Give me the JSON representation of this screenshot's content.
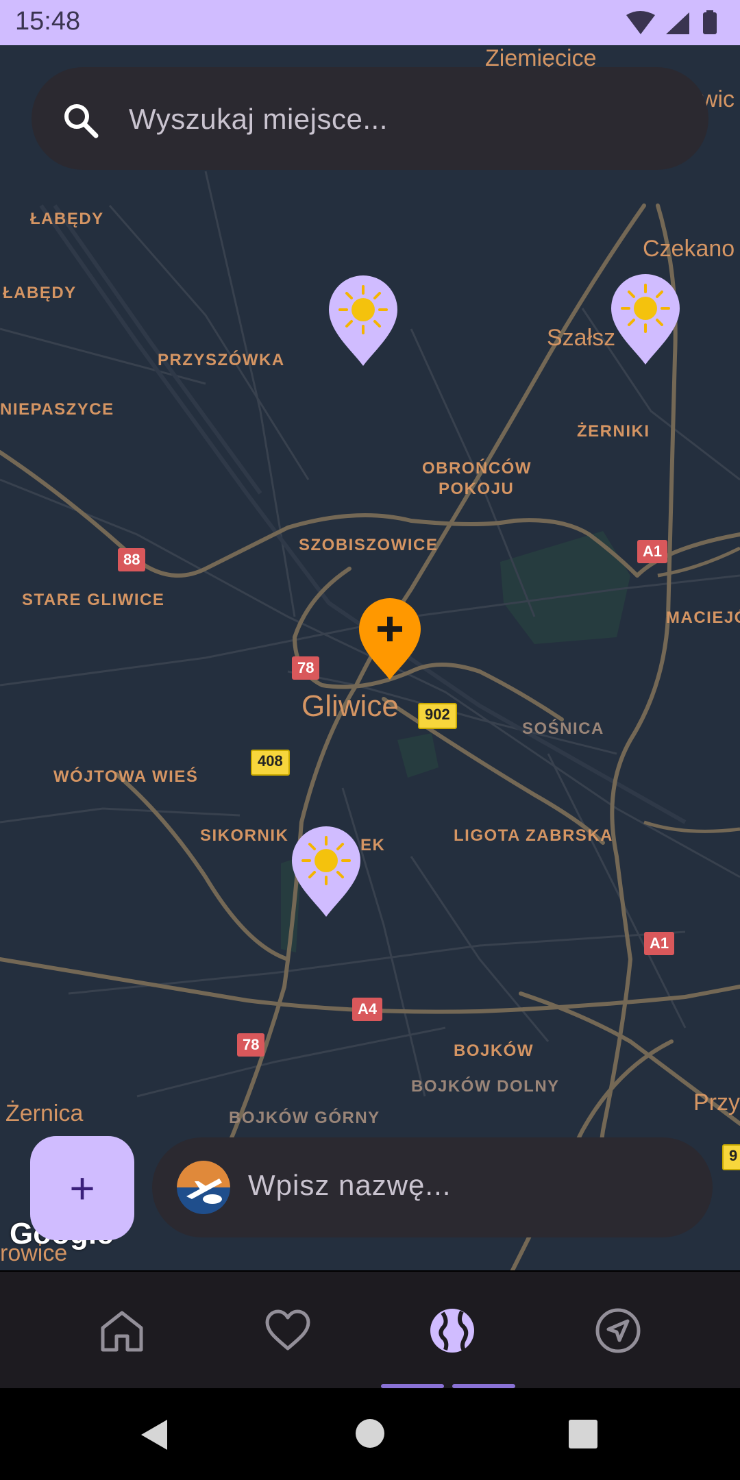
{
  "status_bar": {
    "time": "15:48"
  },
  "search": {
    "placeholder": "Wyszukaj miejsce..."
  },
  "map": {
    "district_labels": [
      "ŁABĘDY",
      "ŁABĘDY",
      "PRZYSZÓWKA",
      "NIEPASZYCE",
      "OBROŃCÓW",
      "POKOJU",
      "ŻERNIKI",
      "SZOBISZOWICE",
      "STARE GLIWICE",
      "MACIEJÓ",
      "SOŚNICA",
      "WÓJTOWA WIEŚ",
      "SIKORNIK",
      "EK",
      "LIGOTA ZABRSKA",
      "BOJKÓW",
      "BOJKÓW DOLNY",
      "BOJKÓW GÓRNY"
    ],
    "city_labels": [
      "Gliwice",
      "Ziemięcice",
      "Czekano",
      "Szałsz",
      "Żernica",
      "Przy",
      "rowice",
      "owic"
    ],
    "road_shields": [
      "88",
      "78",
      "A1",
      "902",
      "408",
      "A1",
      "A4",
      "78",
      "9"
    ],
    "weather_pins": [
      "sun-pin",
      "sun-pin",
      "sun-pin"
    ],
    "add_pin": "add-location-pin",
    "attribution": "Google"
  },
  "fab": {
    "label": "+"
  },
  "name_input": {
    "placeholder": "Wpisz nazwę..."
  },
  "bottom_nav": {
    "items": [
      "home-icon",
      "heart-icon",
      "globe-icon",
      "navigation-icon"
    ],
    "active": "globe-icon"
  },
  "colors": {
    "accent": "#d0bcff",
    "map_bg": "#242f3e",
    "label": "#d59563",
    "marker": "#ff9800"
  }
}
